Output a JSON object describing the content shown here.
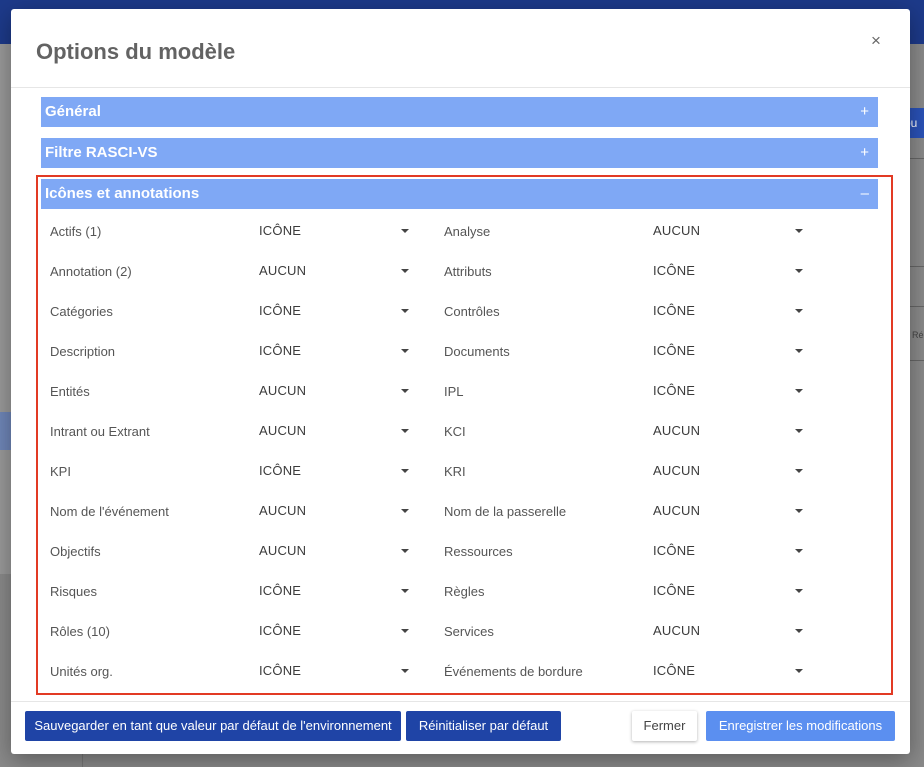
{
  "modal": {
    "title": "Options du modèle",
    "close_glyph": "×"
  },
  "sections": [
    {
      "label": "Général",
      "toggle": "+"
    },
    {
      "label": "Filtre RASCI-VS",
      "toggle": "+"
    },
    {
      "label": "Icônes et annotations",
      "toggle": "–"
    }
  ],
  "options_left": [
    {
      "label": "Actifs (1)",
      "value": "ICÔNE"
    },
    {
      "label": "Annotation (2)",
      "value": "AUCUN"
    },
    {
      "label": "Catégories",
      "value": "ICÔNE"
    },
    {
      "label": "Description",
      "value": "ICÔNE"
    },
    {
      "label": "Entités",
      "value": "AUCUN"
    },
    {
      "label": "Intrant ou Extrant",
      "value": "AUCUN"
    },
    {
      "label": "KPI",
      "value": "ICÔNE"
    },
    {
      "label": "Nom de l'événement",
      "value": "AUCUN"
    },
    {
      "label": "Objectifs",
      "value": "AUCUN"
    },
    {
      "label": "Risques",
      "value": "ICÔNE"
    },
    {
      "label": "Rôles (10)",
      "value": "ICÔNE"
    },
    {
      "label": "Unités org.",
      "value": "ICÔNE"
    }
  ],
  "options_right": [
    {
      "label": "Analyse",
      "value": "AUCUN"
    },
    {
      "label": "Attributs",
      "value": "ICÔNE"
    },
    {
      "label": "Contrôles",
      "value": "ICÔNE"
    },
    {
      "label": "Documents",
      "value": "ICÔNE"
    },
    {
      "label": "IPL",
      "value": "ICÔNE"
    },
    {
      "label": "KCI",
      "value": "AUCUN"
    },
    {
      "label": "KRI",
      "value": "AUCUN"
    },
    {
      "label": "Nom de la passerelle",
      "value": "AUCUN"
    },
    {
      "label": "Ressources",
      "value": "ICÔNE"
    },
    {
      "label": "Règles",
      "value": "ICÔNE"
    },
    {
      "label": "Services",
      "value": "AUCUN"
    },
    {
      "label": "Événements de bordure",
      "value": "ICÔNE"
    }
  ],
  "footer": {
    "save_default_label": "Sauvegarder en tant que valeur par défaut de l'environnement",
    "reset_label": "Réinitialiser par défaut",
    "close_label": "Fermer",
    "save_label": "Enregistrer les modifications"
  },
  "background": {
    "right_button_text": "ou",
    "right_side_text": "Ré"
  },
  "colors": {
    "section_header": "#7fa8f5",
    "highlight_border": "#e23a24",
    "dark_button": "#1f44a6",
    "primary_button": "#5b8ff0"
  }
}
